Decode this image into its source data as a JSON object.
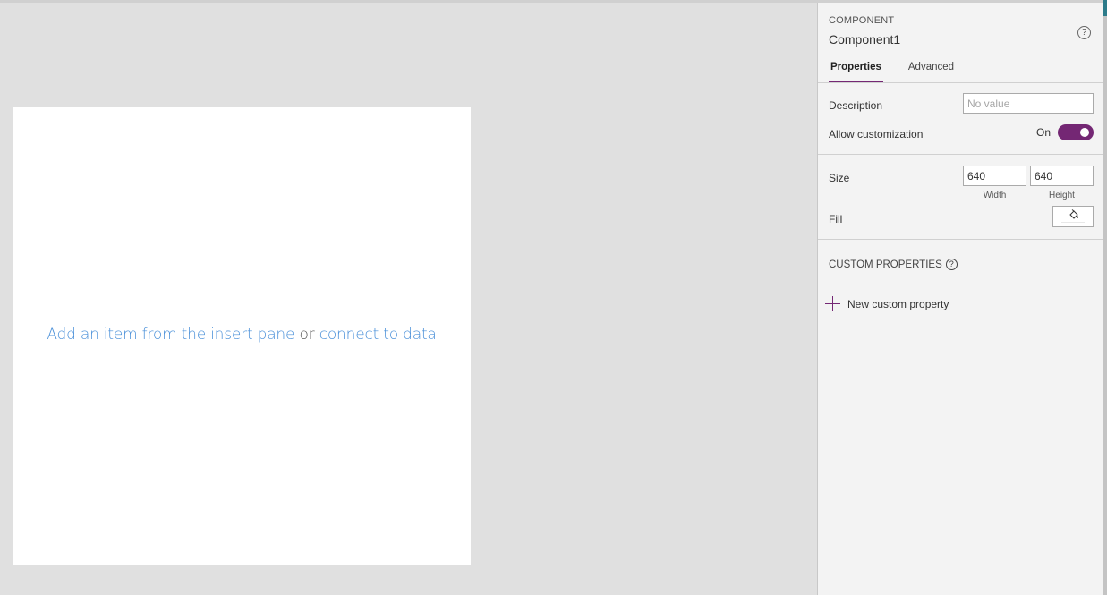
{
  "canvas": {
    "link_insert": "Add an item from the insert pane",
    "or_text": "or",
    "link_connect": "connect to data"
  },
  "panel": {
    "kind": "COMPONENT",
    "name": "Component1",
    "help": "?",
    "tabs": [
      {
        "label": "Properties",
        "active": true
      },
      {
        "label": "Advanced",
        "active": false
      }
    ],
    "description": {
      "label": "Description",
      "placeholder": "No value"
    },
    "allow_customization": {
      "label": "Allow customization",
      "state_text": "On",
      "value": true
    },
    "size": {
      "label": "Size",
      "width": "640",
      "height": "640",
      "width_label": "Width",
      "height_label": "Height"
    },
    "fill": {
      "label": "Fill"
    },
    "custom_properties": {
      "header": "CUSTOM PROPERTIES",
      "help": "?",
      "new_label": "New custom property"
    }
  },
  "colors": {
    "accent": "#742774",
    "link": "#4a90d9"
  }
}
